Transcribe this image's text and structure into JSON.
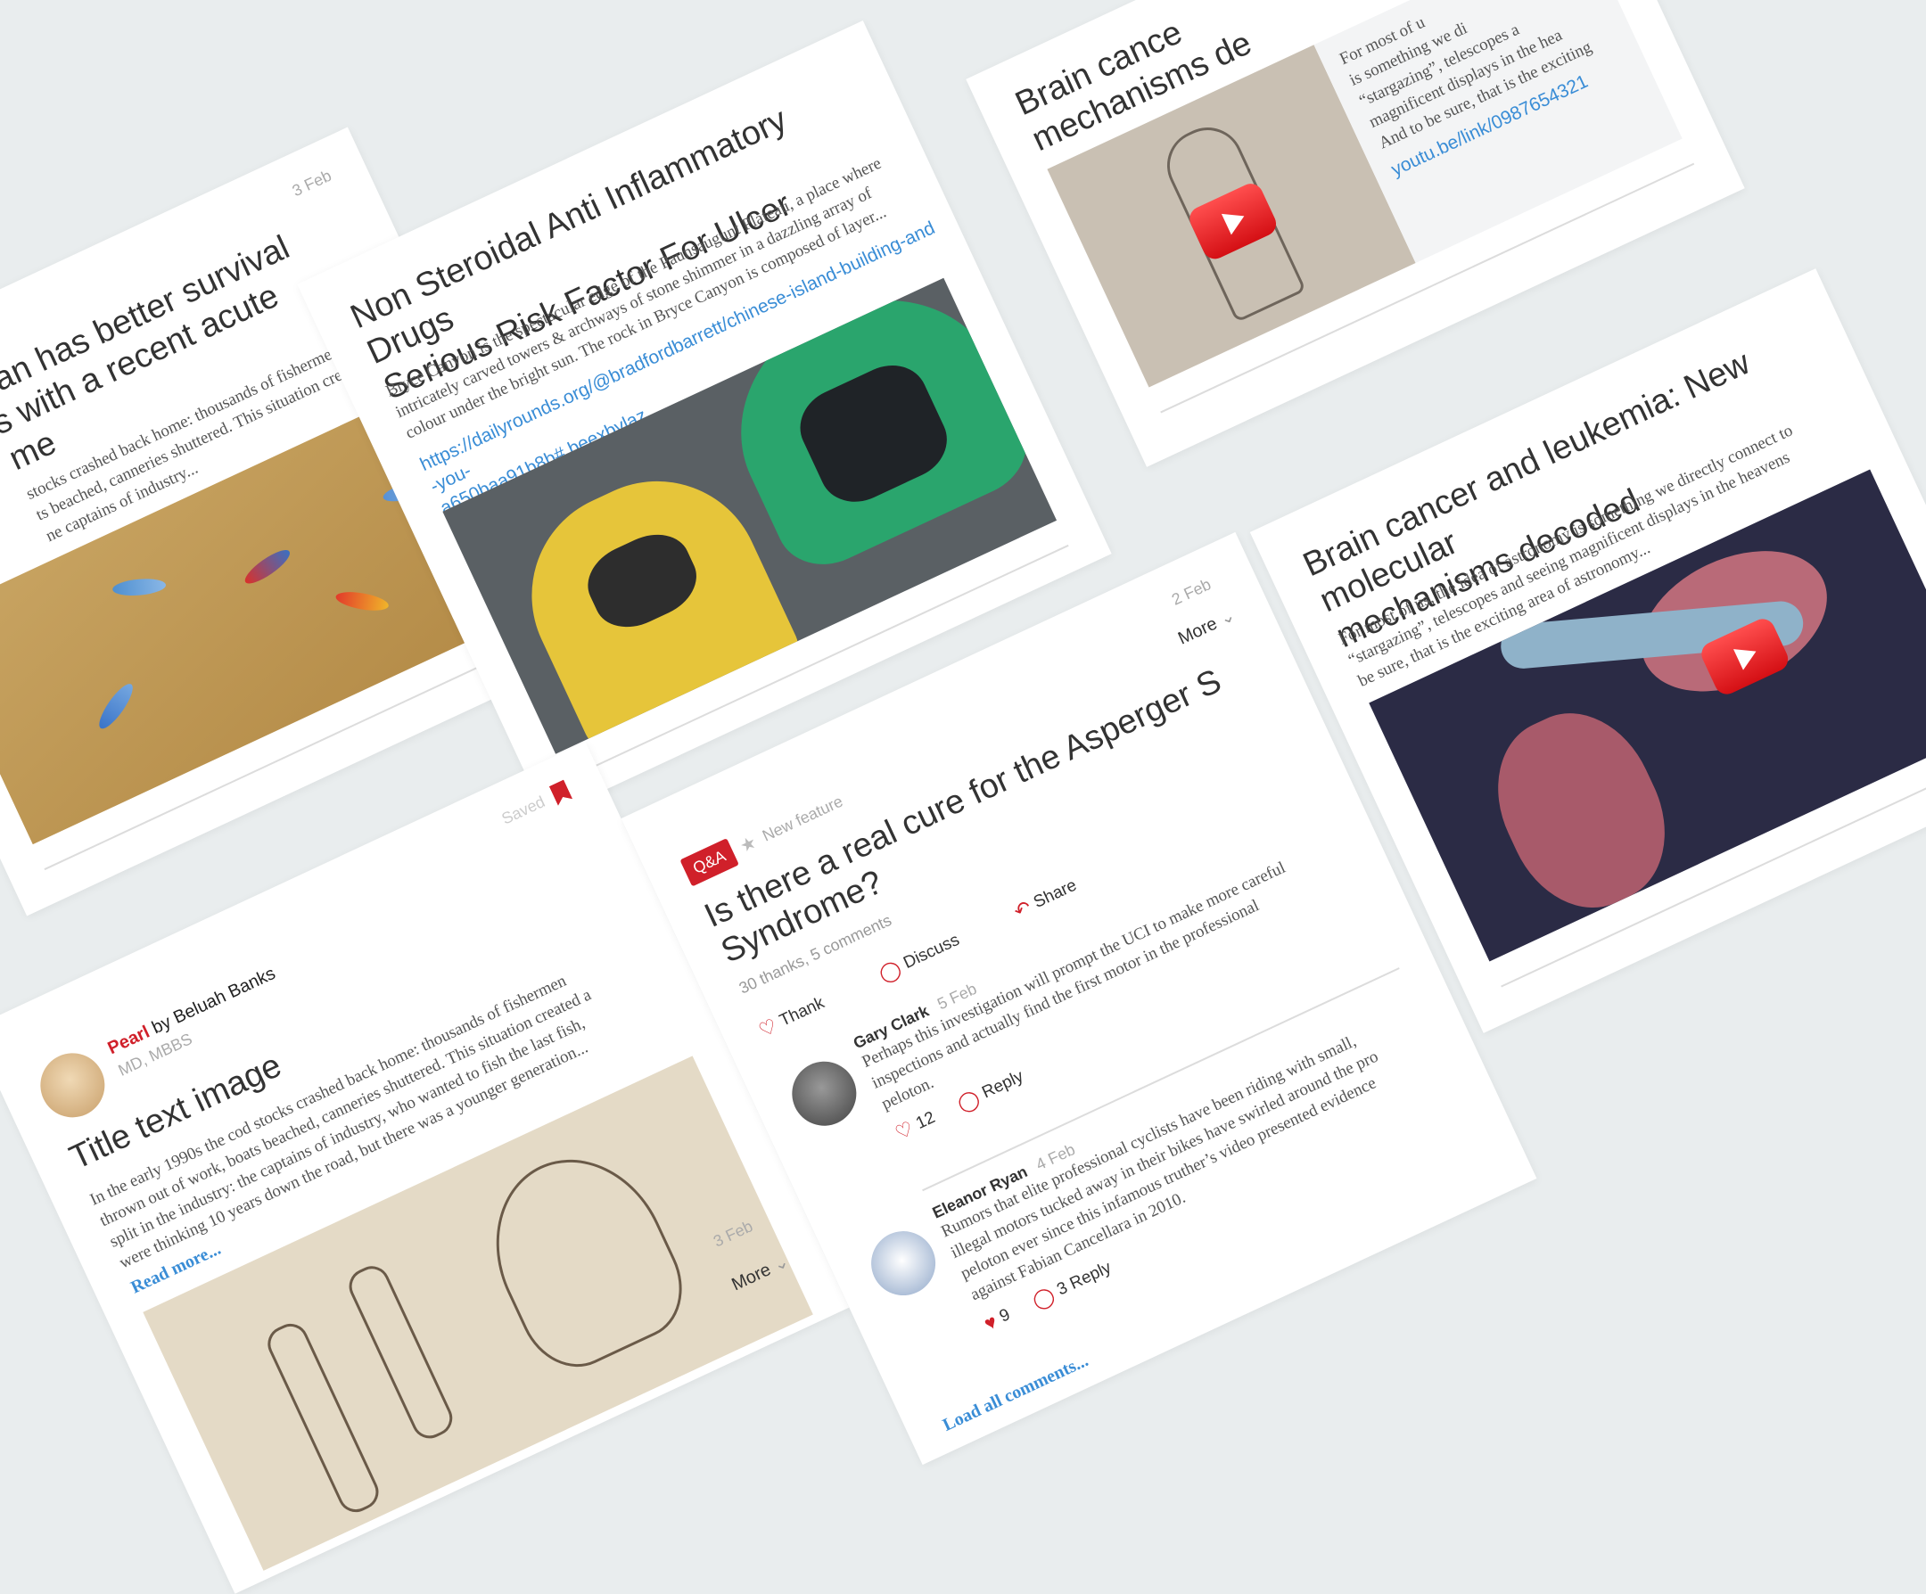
{
  "card_a": {
    "date": "3 Feb",
    "title": "Cuban has better survival rates with a recent acute outcome",
    "title_visible_lines": [
      "ban has better survival",
      "s with a recent acute",
      "me"
    ],
    "excerpt_lines": [
      "stocks crashed back home: thousands of fishermen",
      "ts beached, canneries shuttered. This situation created a",
      "ne captains of industry..."
    ]
  },
  "card_b": {
    "title": "Non Steroidal Anti Inflammatory Drugs Serious Risk Factor For Ulcer",
    "title_lines": [
      "Non Steroidal Anti Inflammatory Drugs",
      "Serious Risk Factor For Ulcer"
    ],
    "excerpt_lines": [
      "Bryce Canyon is the spectacular edge of the Paunsaugunt Plateau, a place where",
      "intricately carved towers & archways of stone shimmer in a dazzling array of",
      "colour under the bright sun. The rock in Bryce Canyon is composed of layer..."
    ],
    "link_lines": [
      "https://dailyrounds.org/@bradfordbarrett/chinese-island-building-and-you-",
      "a650baa91b8b#.beexbvlaz"
    ]
  },
  "card_c": {
    "title_lines": [
      "Brain cance",
      "mechanisms de"
    ],
    "excerpt_lines": [
      "For most of u",
      "is something we di",
      "“stargazing”, telescopes a",
      "magnificent displays in the hea",
      "And to be sure, that is the exciting"
    ],
    "link": "youtu.be/link/0987654321"
  },
  "card_d": {
    "title_lines": [
      "Brain cancer and leukemia: New molecular",
      "mechanisms decoded"
    ],
    "excerpt_lines": [
      "For most of us, the idea of astronomy is something we directly connect to",
      "“stargazing”, telescopes and seeing magnificent displays in the heavens",
      "be sure, that is the exciting area of astronomy..."
    ]
  },
  "card_e": {
    "saved_label": "Saved",
    "author_name": "Pearl",
    "by_label": "by",
    "author_rest": "Beluah Banks",
    "degree": "MD, MBBS",
    "title": "Title text image",
    "excerpt_lines": [
      "In the early 1990s the cod stocks crashed back home: thousands of fishermen",
      "thrown out of work, boats beached, canneries shuttered. This situation created a",
      "split in the industry: the captains of industry, who wanted to fish the last fish,",
      "were thinking 10 years down the road, but there was a younger generation..."
    ],
    "read_more": "Read more...",
    "date": "3 Feb",
    "more": "More"
  },
  "card_f": {
    "date": "2 Feb",
    "more": "More",
    "badge": "Q&A",
    "feature_label": "New feature",
    "title_lines": [
      "Is there a real cure for the Asperger S",
      "Syndrome?"
    ],
    "stats": "30 thanks, 5 comments",
    "actions": {
      "share": "Share",
      "discuss": "Discuss",
      "thank": "Thank"
    },
    "comments": [
      {
        "name": "Gary Clark",
        "date": "5 Feb",
        "text_lines": [
          "Perhaps this investigation will prompt the UCI to make more careful",
          "inspections and actually find the first motor in the professional",
          "peloton."
        ],
        "likes": "12",
        "reply": "Reply"
      },
      {
        "name": "Eleanor Ryan",
        "date": "4 Feb",
        "text_lines": [
          "Rumors that elite professional cyclists have been riding with small,",
          "illegal motors tucked away in their bikes have swirled around the pro",
          "peloton ever since this infamous truther’s video presented evidence",
          "against Fabian Cancellara in 2010."
        ],
        "likes": "9",
        "reply": "3 Reply"
      }
    ],
    "load_all": "Load all comments..."
  },
  "colors": {
    "accent_red": "#d0202a",
    "link_blue": "#3a8dd6",
    "background": "#e9edee"
  }
}
